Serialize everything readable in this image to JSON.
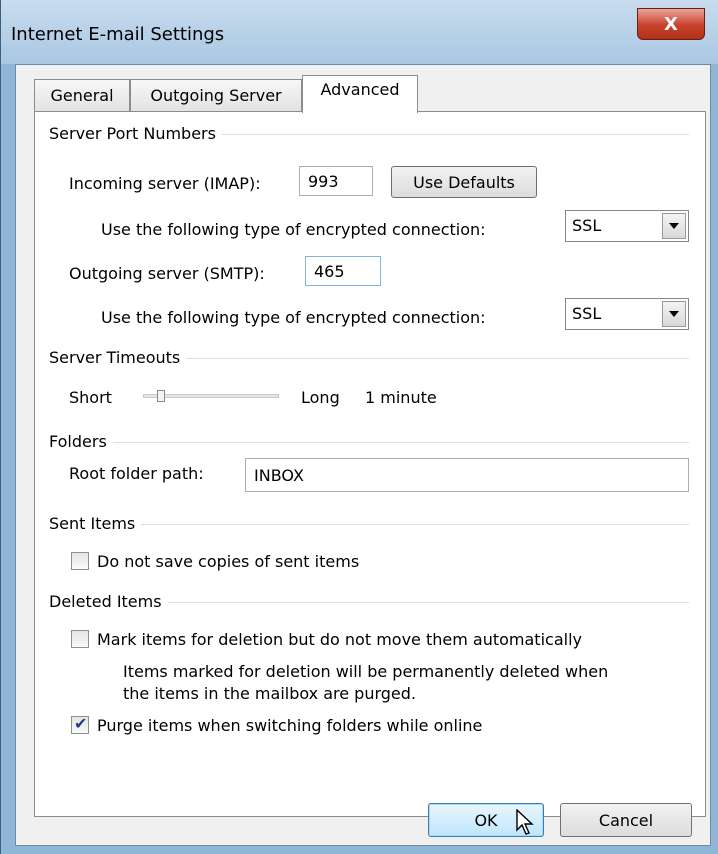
{
  "window": {
    "title": "Internet E-mail Settings",
    "close_glyph": "X"
  },
  "tabs": [
    {
      "label": "General"
    },
    {
      "label": "Outgoing Server"
    },
    {
      "label": "Advanced"
    }
  ],
  "server_ports": {
    "group_title": "Server Port Numbers",
    "incoming_label": "Incoming server (IMAP):",
    "incoming_value": "993",
    "use_defaults_label": "Use Defaults",
    "encrypt_label_1": "Use the following type of encrypted connection:",
    "incoming_encryption": "SSL",
    "outgoing_label": "Outgoing server (SMTP):",
    "outgoing_value": "465",
    "encrypt_label_2": "Use the following type of encrypted connection:",
    "outgoing_encryption": "SSL"
  },
  "timeouts": {
    "group_title": "Server Timeouts",
    "short_label": "Short",
    "long_label": "Long",
    "value_label": "1 minute",
    "slider_level": 0.1
  },
  "folders": {
    "group_title": "Folders",
    "root_label": "Root folder path:",
    "root_value": "INBOX"
  },
  "sent_items": {
    "group_title": "Sent Items",
    "no_copies_label": "Do not save copies of sent items",
    "no_copies_checked": false
  },
  "deleted_items": {
    "group_title": "Deleted Items",
    "mark_label": "Mark items for deletion but do not move them automatically",
    "mark_checked": false,
    "info_line1": "Items marked for deletion will be permanently deleted when",
    "info_line2": "the items in the mailbox are purged.",
    "purge_label": "Purge items when switching folders while online",
    "purge_checked": true
  },
  "buttons": {
    "ok": "OK",
    "cancel": "Cancel"
  },
  "colors": {
    "title_bar": "#a9c7e2",
    "close_button": "#c9402b",
    "checkmark": "#233d88"
  }
}
